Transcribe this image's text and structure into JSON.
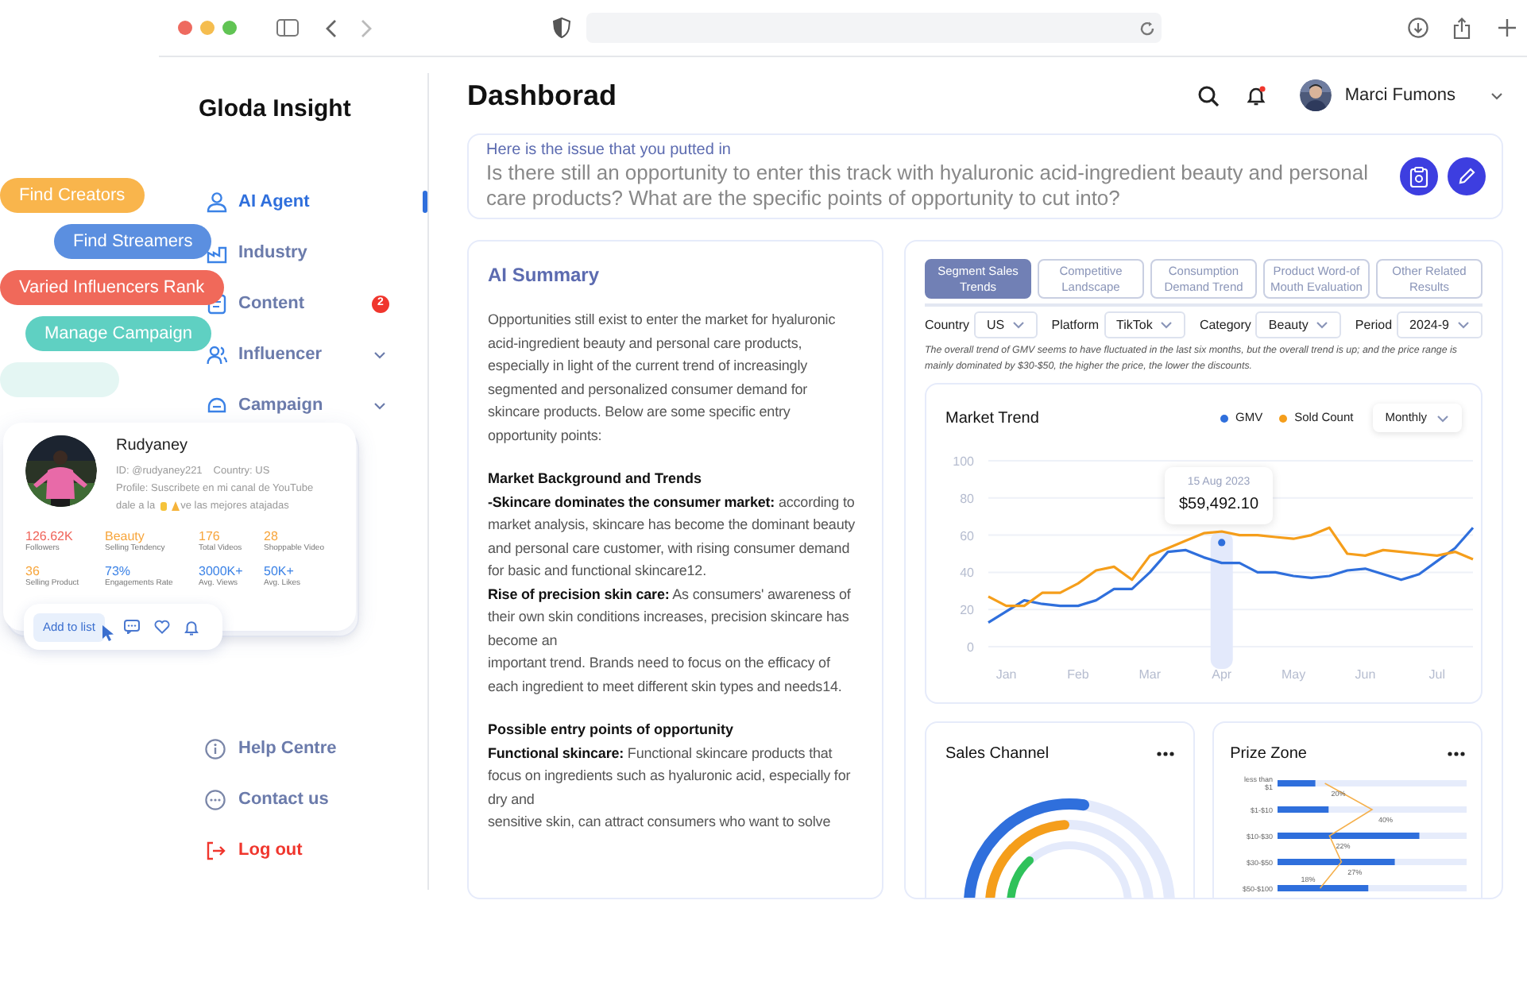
{
  "sidebar": {
    "brand": "Gloda Insight",
    "nav": [
      {
        "label": "AI Agent",
        "selected": true
      },
      {
        "label": "Industry",
        "selected": false
      },
      {
        "label": "Content",
        "selected": false,
        "badge": "2"
      },
      {
        "label": "Influencer",
        "selected": false,
        "expandable": true
      },
      {
        "label": "Campaign",
        "selected": false,
        "expandable": true
      }
    ],
    "footer": [
      {
        "label": "Help Centre",
        "kind": "help"
      },
      {
        "label": "Contact us",
        "kind": "contact"
      },
      {
        "label": "Log out",
        "kind": "logout"
      }
    ]
  },
  "feature_pills": [
    {
      "label": "Find Creators",
      "color": "#f9b54c"
    },
    {
      "label": "Find Streamers",
      "color": "#5b8fe0"
    },
    {
      "label": "Varied Influencers Rank",
      "color": "#f0695a"
    },
    {
      "label": "Manage Campaign",
      "color": "#5fd0c2"
    },
    {
      "color": "#e4f6f3"
    }
  ],
  "profile_card": {
    "name": "Rudyaney",
    "id": "ID: @rudyaney221",
    "country": "Country: US",
    "profile_line1": "Profile: Suscribete en mi canal de YouTube",
    "profile_line2_before": "dale a la",
    "profile_line2_after": "ve las mejores atajadas",
    "stats": [
      {
        "value": "126.62K",
        "label": "Followers",
        "color": "#f0645a"
      },
      {
        "value": "Beauty",
        "label": "Selling Tendency",
        "color": "#f7a53b"
      },
      {
        "value": "176",
        "label": "Total Videos",
        "color": "#f7a53b"
      },
      {
        "value": "28",
        "label": "Shoppable Video",
        "color": "#f7a53b"
      },
      {
        "value": "36",
        "label": "Selling Product",
        "color": "#f7a53b"
      },
      {
        "value": "73%",
        "label": "Engagements Rate",
        "color": "#3b82e6"
      },
      {
        "value": "3000K+",
        "label": "Avg. Views",
        "color": "#3b82e6"
      },
      {
        "value": "50K+",
        "label": "Avg. Likes",
        "color": "#3b82e6"
      }
    ],
    "add_button": "Add to list"
  },
  "header": {
    "title": "Dashborad",
    "user": "Marci Fumons",
    "has_notification": true
  },
  "issue": {
    "label": "Here is the issue that you putted in",
    "question": "Is there still an opportunity to enter this track with hyaluronic acid-ingredient beauty and personal care products? What are the specific points of opportunity to cut into?"
  },
  "summary": {
    "title": "AI Summary",
    "paragraphs": [
      {
        "kind": "text",
        "text": "Opportunities still exist to enter the market for hyaluronic acid-ingredient beauty and personal care products, especially in light of the current trend of increasingly segmented and personalized consumer demand for skincare products. Below are some specific entry opportunity points:"
      },
      {
        "kind": "heading",
        "text": "Market Background and Trends"
      },
      {
        "kind": "text",
        "text": "**-Skincare dominates the consumer market:** according to market analysis, skincare has become the dominant beauty and personal care customer, with rising consumer demand for basic and functional skincare12."
      },
      {
        "kind": "text",
        "text": "**Rise of precision skin care:** As consumers' awareness of their own skin conditions increases, precision skincare has become an"
      },
      {
        "kind": "text",
        "text": "important trend. Brands need to focus on the efficacy of each ingredient to meet different skin types and needs14."
      },
      {
        "kind": "heading",
        "text": "Possible entry points of opportunity"
      },
      {
        "kind": "text",
        "text": "**Functional skincare:** Functional skincare products that focus on ingredients such as hyaluronic acid, especially for dry and"
      },
      {
        "kind": "text",
        "text": "sensitive skin, can attract consumers who want to solve"
      }
    ]
  },
  "analysis": {
    "tabs": [
      {
        "label": "Segment Sales Trends",
        "selected": true
      },
      {
        "label": "Competitive Landscape",
        "selected": false
      },
      {
        "label": "Consumption Demand Trend",
        "selected": false
      },
      {
        "label": "Product Word-of Mouth Evaluation",
        "selected": false
      },
      {
        "label": "Other Related Results",
        "selected": false
      }
    ],
    "filters": [
      {
        "label": "Country",
        "value": "US"
      },
      {
        "label": "Platform",
        "value": "TikTok"
      },
      {
        "label": "Category",
        "value": "Beauty"
      },
      {
        "label": "Period",
        "value": "2024-9"
      }
    ],
    "note": "The overall trend of GMV seems to have fluctuated in the last six months, but the overall trend is up; and the price range is mainly dominated by $30-$50, the higher the price, the lower the discounts.",
    "market_trend": {
      "title": "Market Trend",
      "period": "Monthly",
      "tooltip": {
        "date": "15 Aug 2023",
        "value": "$59,492.10"
      },
      "chart_data": {
        "type": "line",
        "categories": [
          null,
          "Jan",
          null,
          null,
          null,
          "Feb",
          null,
          null,
          null,
          "Mar",
          null,
          null,
          null,
          "Apr",
          null,
          null,
          null,
          "May",
          null,
          null,
          null,
          "Jun",
          null,
          null,
          null,
          "Jul",
          null,
          null
        ],
        "series": [
          {
            "name": "GMV",
            "color": "#2f6fdc",
            "values": [
              13,
              19,
              25,
              23,
              22,
              22,
              25,
              31,
              31,
              40,
              51,
              52,
              48,
              45,
              45,
              40,
              40,
              38,
              37,
              38,
              41,
              42,
              39,
              36,
              39,
              46,
              53,
              64
            ]
          },
          {
            "name": "Sold Count",
            "color": "#f59e1b",
            "values": [
              27,
              22,
              22,
              29,
              29,
              34,
              41,
              43,
              36,
              49,
              53,
              57,
              61,
              62,
              60,
              60,
              59,
              58,
              60,
              64,
              50,
              49,
              52,
              51,
              50,
              49,
              51,
              47
            ]
          }
        ],
        "ylim": [
          0,
          100
        ],
        "grid": true,
        "yticks": [
          0,
          20,
          40,
          60,
          80,
          100
        ]
      }
    },
    "sales_channel": {
      "title": "Sales Channel"
    },
    "prize_zone": {
      "title": "Prize Zone",
      "categories": [
        "less than $1",
        "$1-$10",
        "$10-$30",
        "$30-$50",
        "$50-$100"
      ],
      "percent_labels": [
        "20%",
        "40%",
        "22%",
        "27%",
        "18%"
      ]
    }
  }
}
